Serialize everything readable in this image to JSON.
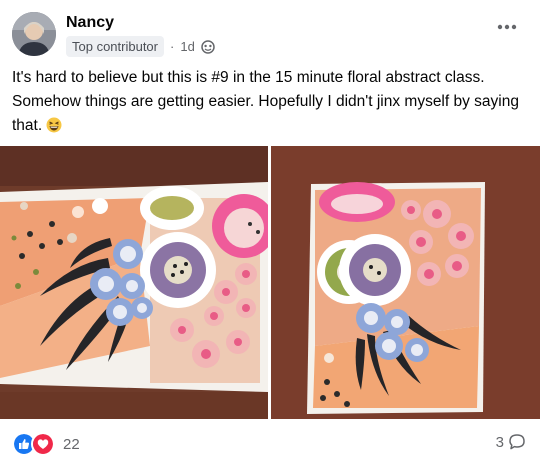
{
  "post": {
    "author": "Nancy",
    "badge": "Top contributor",
    "separator": "·",
    "time": "1d",
    "text": "It's hard to believe but this is #9 in the 15 minute floral abstract class. Somehow things are getting easier. Hopefully I didn't jinx myself by saying that.",
    "emoji": "grinning-squinting-face"
  },
  "photos": [
    {
      "name": "floral-painting-landscape"
    },
    {
      "name": "floral-painting-portrait"
    }
  ],
  "reactions": {
    "count": "22",
    "types": [
      "like",
      "love"
    ]
  },
  "comments": {
    "count": "3"
  },
  "colors": {
    "like_blue": "#1877f2",
    "love_red": "#f02849",
    "secondary_text": "#65676b",
    "badge_bg": "#eef0f3"
  },
  "icons": [
    "globe-icon",
    "more-options-icon",
    "comment-icon",
    "like-reaction-icon",
    "love-reaction-icon"
  ]
}
